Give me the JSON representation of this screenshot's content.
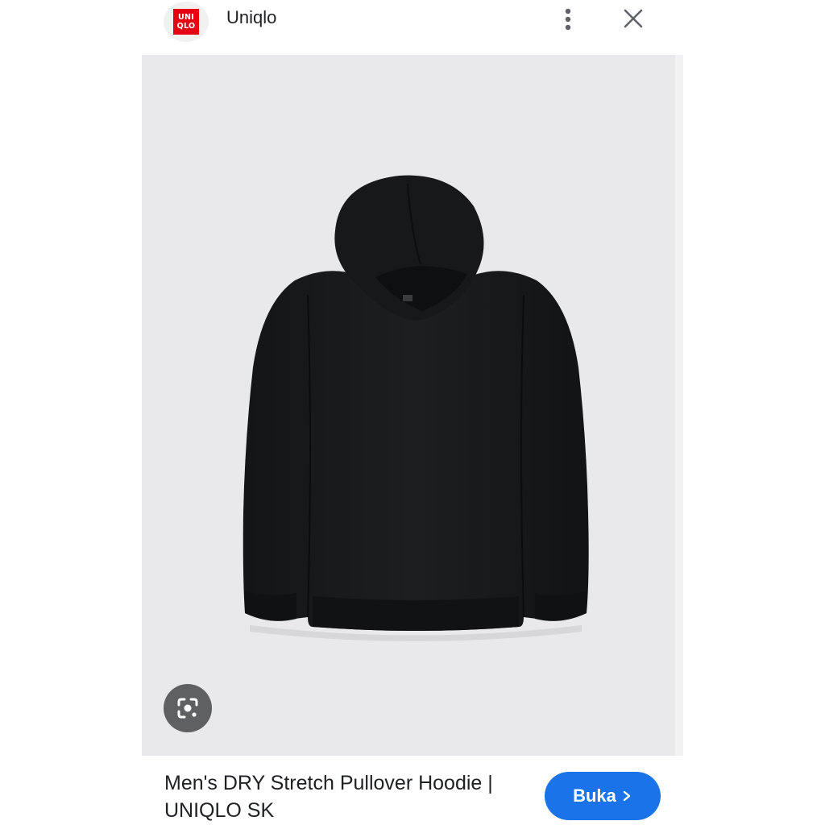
{
  "header": {
    "logo_text_top": "UNI",
    "logo_text_bottom": "QLO",
    "site_name": "Uniqlo",
    "more_icon": "more-vert-icon",
    "close_icon": "close-icon"
  },
  "image": {
    "subject": "black-hoodie-product-image",
    "lens_icon": "google-lens-icon"
  },
  "footer": {
    "title": "Men's DRY Stretch Pullover Hoodie | UNIQLO SK",
    "open_label": "Buka",
    "open_icon": "chevron-right-icon"
  },
  "colors": {
    "brand_red": "#e60012",
    "button_blue": "#1a73e8",
    "image_bg": "#e9e9eb",
    "text_dark": "#202124"
  }
}
